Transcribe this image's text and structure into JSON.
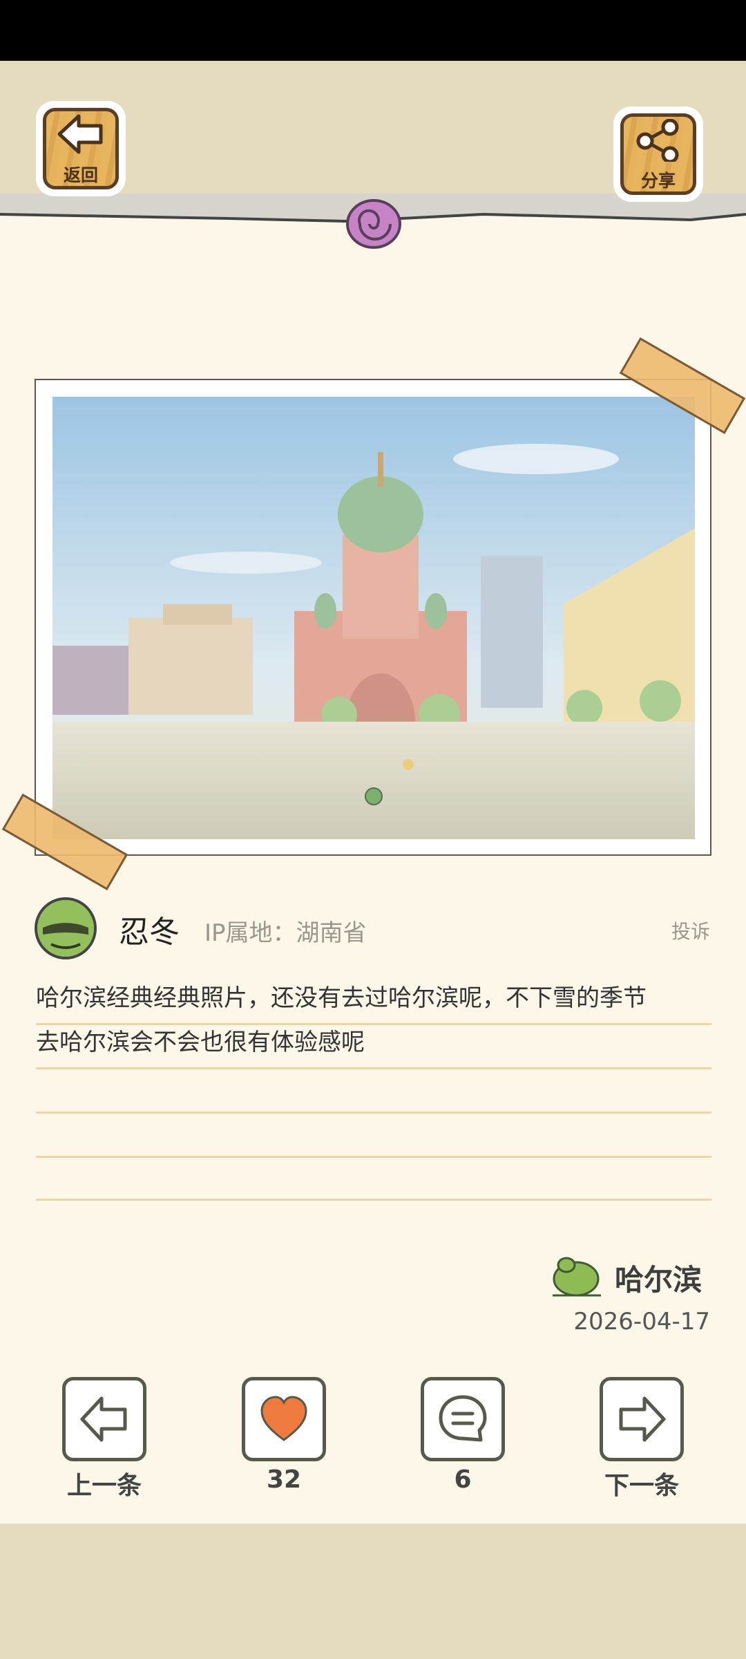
{
  "header": {
    "back_label": "返回",
    "share_label": "分享"
  },
  "post": {
    "username": "忍冬",
    "ip_location": "IP属地：湖南省",
    "report_label": "投诉",
    "content_line1": "哈尔滨经典经典照片，还没有去过哈尔滨呢，不下雪的季节",
    "content_line2": "去哈尔滨会不会也很有体验感呢",
    "location_tag": "哈尔滨",
    "date": "2026-04-17"
  },
  "actions": {
    "prev_label": "上一条",
    "likes": "32",
    "comments": "6",
    "next_label": "下一条"
  },
  "colors": {
    "paper": "#fcf7e9",
    "band": "#e5dcbf",
    "heart": "#ef7a3d",
    "wood": "#e8b55f"
  }
}
